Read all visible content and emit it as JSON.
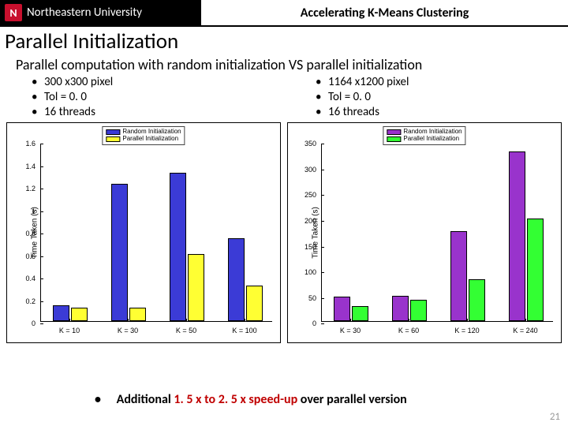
{
  "header": {
    "university": "Northeastern University",
    "title": "Accelerating K-Means Clustering"
  },
  "section_title": "Parallel Initialization",
  "subtitle": "Parallel computation with random initialization VS parallel initialization",
  "left_params": [
    "300 x300 pixel",
    "Tol = 0. 0",
    "16 threads"
  ],
  "right_params": [
    "1164 x1200 pixel",
    "Tol = 0. 0",
    "16 threads"
  ],
  "conclusion_prefix": "Additional ",
  "conclusion_em": "1. 5 x to 2. 5 x speed-up",
  "conclusion_suffix": " over parallel version",
  "page_number": "21",
  "legend": {
    "s1": "Random Initialization",
    "s2": "Parallel Initialization"
  },
  "chart_data": [
    {
      "type": "bar",
      "title": "",
      "xlabel": "",
      "ylabel": "Time Taken (s)",
      "categories": [
        "K = 10",
        "K = 30",
        "K = 50",
        "K = 100"
      ],
      "ylim": [
        0,
        1.6
      ],
      "yticks": [
        0,
        0.2,
        0.4,
        0.6,
        0.8,
        1.0,
        1.2,
        1.4,
        1.6
      ],
      "colors": {
        "s1": "#3b3bd6",
        "s2": "#ffff33"
      },
      "series": [
        {
          "name": "Random Initialization",
          "values": [
            0.14,
            1.22,
            1.32,
            0.74
          ]
        },
        {
          "name": "Parallel Initialization",
          "values": [
            0.12,
            0.12,
            0.6,
            0.32
          ]
        }
      ]
    },
    {
      "type": "bar",
      "title": "",
      "xlabel": "",
      "ylabel": "Time Taken (s)",
      "categories": [
        "K = 30",
        "K = 60",
        "K = 120",
        "K = 240"
      ],
      "ylim": [
        0,
        350
      ],
      "yticks": [
        0,
        50,
        100,
        150,
        200,
        250,
        300,
        350
      ],
      "colors": {
        "s1": "#9933cc",
        "s2": "#33ff33"
      },
      "series": [
        {
          "name": "Random Initialization",
          "values": [
            48,
            50,
            175,
            330
          ]
        },
        {
          "name": "Parallel Initialization",
          "values": [
            30,
            42,
            82,
            200
          ]
        }
      ]
    }
  ]
}
